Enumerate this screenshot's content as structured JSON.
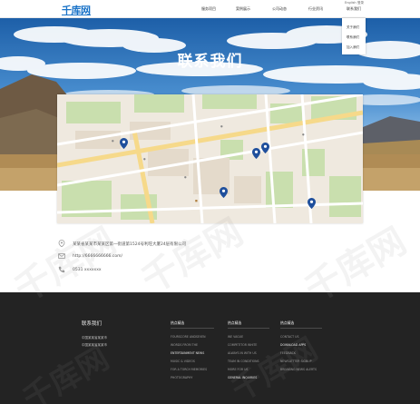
{
  "header": {
    "logo": "千库网",
    "nav": [
      "服务项目",
      "案例展示",
      "公司动态",
      "行业资讯",
      "联系我们"
    ],
    "topbar": [
      "English",
      "登录"
    ],
    "dropdown": [
      "关于我们",
      "联系我们",
      "加入我们"
    ]
  },
  "hero": {
    "title": "联系我们"
  },
  "contact": {
    "address": "某某省某某市某某区第一街道第1524号利旺大厦24层有限公司",
    "website": "http://6666666666.com/",
    "phone": "0531 xxxxxxx"
  },
  "footer": {
    "title": "联系我们",
    "lines": [
      "中国某某省某某市",
      "中国某某省某某市"
    ],
    "columns": [
      {
        "title": "热点精选",
        "links": [
          "FOURSCORE ANDSEVEN",
          "WORDS FROM THE",
          "ENTERTAINMENT NEWS",
          "MUSIC & VIDEOS",
          "FOR A TORCH MEMORIES",
          "PHOTOGRAPHY"
        ]
      },
      {
        "title": "热点精选",
        "links": [
          "WE VAGUE",
          "COMPETITOR WHITE",
          "ALWAYS IN WITH US",
          "TEAM IN CONDITIONS",
          "MORE FOR US",
          "GENERAL INQUIRIES"
        ]
      },
      {
        "title": "热点精选",
        "links": [
          "CONTACT US",
          "DOWNLOAD APPS",
          "FEEDBACK",
          "NEWSLETTER SIGNUP",
          "BREAKING NEWS ALERTS"
        ]
      }
    ]
  },
  "colors": {
    "brand": "#1a73c8",
    "footer_bg": "#232323",
    "marker": "#1f4f9c"
  }
}
